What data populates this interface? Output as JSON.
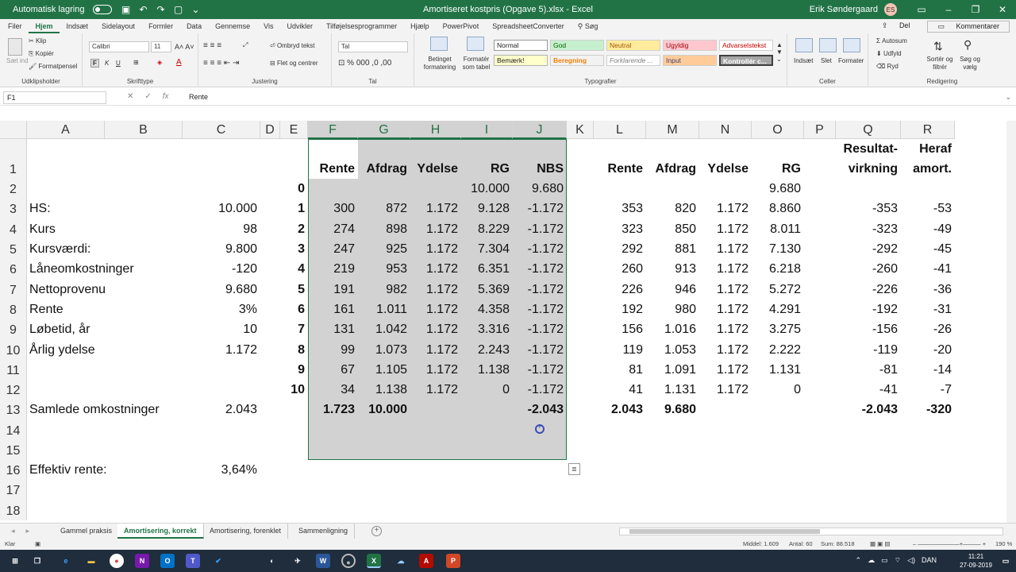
{
  "titlebar": {
    "autosave_label": "Automatisk lagring",
    "doc_title": "Amortiseret kostpris (Opgave 5).xlsx  -  Excel",
    "user_name": "Erik Søndergaard",
    "user_initials": "ES"
  },
  "menu": {
    "tabs": [
      "Filer",
      "Hjem",
      "Indsæt",
      "Sidelayout",
      "Formler",
      "Data",
      "Gennemse",
      "Vis",
      "Udvikler",
      "Tilføjelsesprogrammer",
      "Hjælp",
      "PowerPivot",
      "SpreadsheetConverter",
      "Søg"
    ],
    "share": "Del",
    "comments": "Kommentarer"
  },
  "ribbon": {
    "clipboard": {
      "paste": "Sæt ind",
      "cut": "Klip",
      "copy": "Kopiér",
      "format_painter": "Formatpensel",
      "group": "Udklipsholder"
    },
    "font": {
      "name": "Calibri",
      "size": "11",
      "bold": "F",
      "italic": "K",
      "underline": "U",
      "group": "Skrifttype"
    },
    "alignment": {
      "wrap": "Ombryd tekst",
      "merge": "Flet og centrer",
      "group": "Justering"
    },
    "number": {
      "format": "Tal",
      "group": "Tal"
    },
    "styles": {
      "cond": "Betinget formatering",
      "table": "Formatér som tabel",
      "group": "Typografier",
      "cells": [
        "Normal",
        "God",
        "Neutral",
        "Ugyldig",
        "Advarselstekst",
        "Bemærk!",
        "Beregning",
        "Forklarende ...",
        "Input",
        "Kontrollér c..."
      ]
    },
    "cells": {
      "insert": "Indsæt",
      "delete": "Slet",
      "format": "Formater",
      "group": "Celler"
    },
    "editing": {
      "autosum": "Autosum",
      "fill": "Udfyld",
      "clear": "Ryd",
      "sort": "Sortér og filtrér",
      "find": "Søg og vælg",
      "group": "Redigering"
    }
  },
  "formula": {
    "name_box": "F1",
    "value": "Rente"
  },
  "columns": [
    "A",
    "B",
    "C",
    "D",
    "E",
    "F",
    "G",
    "H",
    "I",
    "J",
    "K",
    "L",
    "M",
    "N",
    "O",
    "P",
    "Q",
    "R"
  ],
  "rows": [
    "1",
    "2",
    "3",
    "4",
    "5",
    "6",
    "7",
    "8",
    "9",
    "10",
    "11",
    "12",
    "13",
    "14",
    "15",
    "16",
    "17",
    "18"
  ],
  "sheet": {
    "labels": {
      "A3": "HS:",
      "A4": "Kurs",
      "A5": "Kursværdi:",
      "A6": "Låneomkostninger",
      "A7": "Nettoprovenu",
      "A8": "Rente",
      "A9": "Løbetid, år",
      "A10": "Årlig ydelse",
      "A13": "Samlede omkostninger",
      "A16": "Effektiv rente:"
    },
    "colC": {
      "C3": "10.000",
      "C4": "98",
      "C5": "9.800",
      "C6": "-120",
      "C7": "9.680",
      "C8": "3%",
      "C9": "10",
      "C10": "1.172",
      "C13": "2.043",
      "C16": "3,64%"
    },
    "headers": {
      "F1": "Rente",
      "G1": "Afdrag",
      "H1": "Ydelse",
      "I1": "RG",
      "J1": "NBS",
      "L1": "Rente",
      "M1": "Afdrag",
      "N1": "Ydelse",
      "O1": "RG",
      "Q0": "Resultat-",
      "Q1": "virkning",
      "R0": "Heraf",
      "R1": "amort."
    },
    "periods": [
      "0",
      "1",
      "2",
      "3",
      "4",
      "5",
      "6",
      "7",
      "8",
      "9",
      "10"
    ],
    "tableF": [
      [
        "",
        "",
        "",
        "10.000",
        "9.680"
      ],
      [
        "300",
        "872",
        "1.172",
        "9.128",
        "-1.172"
      ],
      [
        "274",
        "898",
        "1.172",
        "8.229",
        "-1.172"
      ],
      [
        "247",
        "925",
        "1.172",
        "7.304",
        "-1.172"
      ],
      [
        "219",
        "953",
        "1.172",
        "6.351",
        "-1.172"
      ],
      [
        "191",
        "982",
        "1.172",
        "5.369",
        "-1.172"
      ],
      [
        "161",
        "1.011",
        "1.172",
        "4.358",
        "-1.172"
      ],
      [
        "131",
        "1.042",
        "1.172",
        "3.316",
        "-1.172"
      ],
      [
        "99",
        "1.073",
        "1.172",
        "2.243",
        "-1.172"
      ],
      [
        "67",
        "1.105",
        "1.172",
        "1.138",
        "-1.172"
      ],
      [
        "34",
        "1.138",
        "1.172",
        "0",
        "-1.172"
      ]
    ],
    "totalsF": [
      "1.723",
      "10.000",
      "",
      "",
      "-2.043"
    ],
    "tableL": [
      [
        "",
        "",
        "",
        "9.680",
        "",
        ""
      ],
      [
        "353",
        "820",
        "1.172",
        "8.860",
        "-353",
        "-53"
      ],
      [
        "323",
        "850",
        "1.172",
        "8.011",
        "-323",
        "-49"
      ],
      [
        "292",
        "881",
        "1.172",
        "7.130",
        "-292",
        "-45"
      ],
      [
        "260",
        "913",
        "1.172",
        "6.218",
        "-260",
        "-41"
      ],
      [
        "226",
        "946",
        "1.172",
        "5.272",
        "-226",
        "-36"
      ],
      [
        "192",
        "980",
        "1.172",
        "4.291",
        "-192",
        "-31"
      ],
      [
        "156",
        "1.016",
        "1.172",
        "3.275",
        "-156",
        "-26"
      ],
      [
        "119",
        "1.053",
        "1.172",
        "2.222",
        "-119",
        "-20"
      ],
      [
        "81",
        "1.091",
        "1.172",
        "1.131",
        "-81",
        "-14"
      ],
      [
        "41",
        "1.131",
        "1.172",
        "0",
        "-41",
        "-7"
      ]
    ],
    "totalsL": [
      "2.043",
      "9.680",
      "",
      "",
      "-2.043",
      "-320"
    ]
  },
  "tabs": [
    "Gammel praksis",
    "Amortisering, korrekt",
    "Amortisering, forenklet",
    "Sammenligning"
  ],
  "active_tab": "Amortisering, korrekt",
  "status": {
    "ready": "Klar",
    "average": "Middel: 1.609",
    "count": "Antal: 60",
    "sum": "Sum: 88.518",
    "zoom": "190 %"
  },
  "taskbar": {
    "time": "11:21",
    "date": "27-09-2019",
    "lang": "DAN"
  },
  "colors": {
    "excel_green": "#217346",
    "selection": "#d2d2d2"
  }
}
